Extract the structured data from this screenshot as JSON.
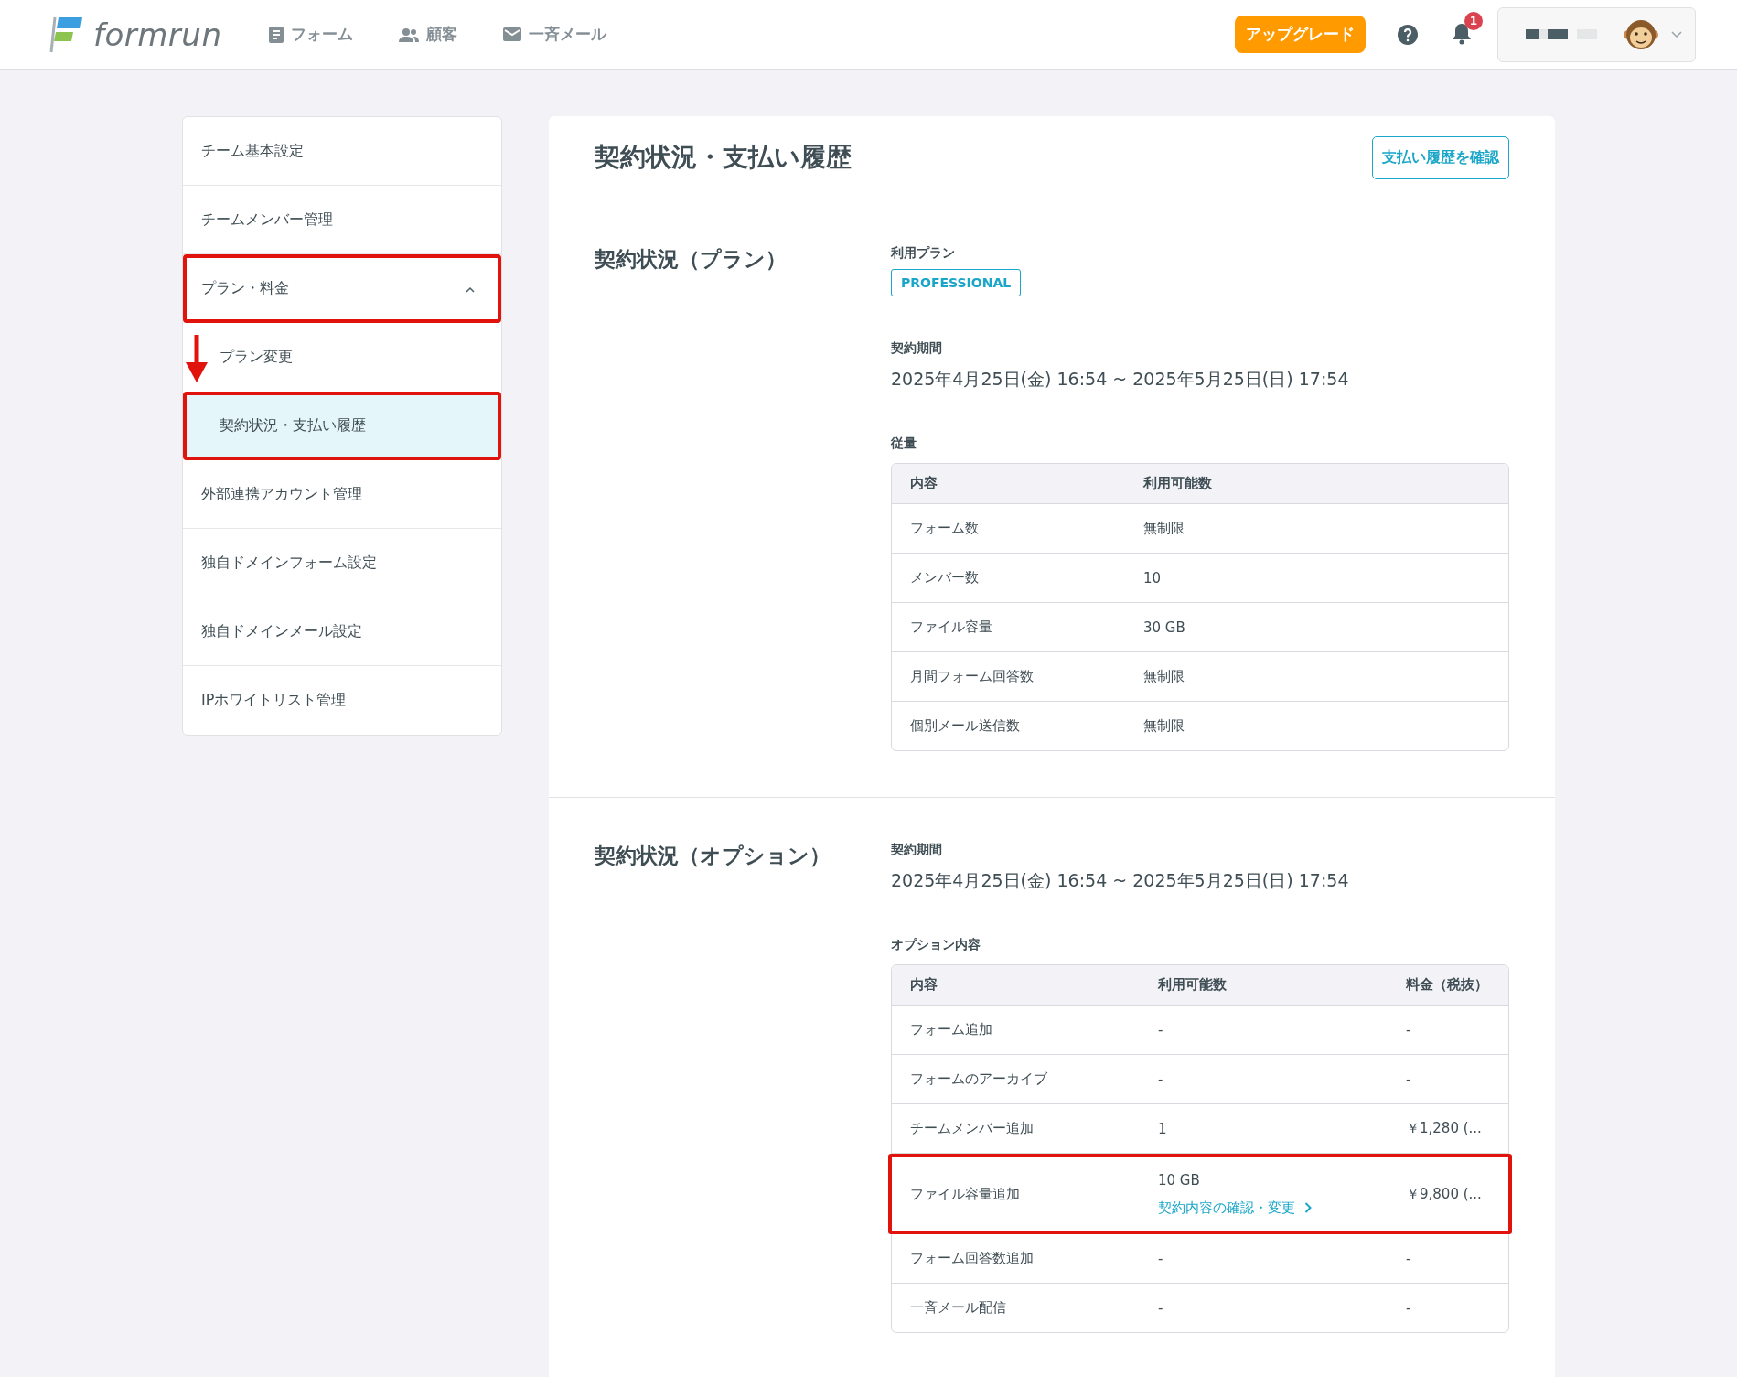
{
  "header": {
    "logo": "formrun",
    "nav": [
      {
        "kind": "form",
        "label": "フォーム"
      },
      {
        "kind": "people",
        "label": "顧客"
      },
      {
        "kind": "mail",
        "label": "一斉メール"
      }
    ],
    "upgrade": "アップグレード",
    "notification_count": "1"
  },
  "sidebar": {
    "items": [
      {
        "label": "チーム基本設定",
        "selected": false,
        "highlighted": false
      },
      {
        "label": "チームメンバー管理",
        "selected": false,
        "highlighted": false
      },
      {
        "label": "プラン・料金",
        "selected": false,
        "highlighted": true,
        "expanded": true,
        "children": [
          {
            "label": "プラン変更",
            "selected": false,
            "highlighted": false,
            "arrow": true
          },
          {
            "label": "契約状況・支払い履歴",
            "selected": true,
            "highlighted": true,
            "arrow": false
          }
        ]
      },
      {
        "label": "外部連携アカウント管理",
        "selected": false,
        "highlighted": false
      },
      {
        "label": "独自ドメインフォーム設定",
        "selected": false,
        "highlighted": false
      },
      {
        "label": "独自ドメインメール設定",
        "selected": false,
        "highlighted": false
      },
      {
        "label": "IPホワイトリスト管理",
        "selected": false,
        "highlighted": false
      }
    ]
  },
  "page": {
    "title": "契約状況・支払い履歴",
    "history_button": "支払い履歴を確認"
  },
  "plan_section": {
    "title": "契約状況（プラン）",
    "plan_label": "利用プラン",
    "plan_badge": "PROFESSIONAL",
    "period_label": "契約期間",
    "period": "2025年4月25日(金) 16:54 ~ 2025年5月25日(日) 17:54",
    "quota_label": "従量",
    "table": {
      "columns": [
        "内容",
        "利用可能数"
      ],
      "rows": [
        [
          "フォーム数",
          "無制限"
        ],
        [
          "メンバー数",
          "10"
        ],
        [
          "ファイル容量",
          "30 GB"
        ],
        [
          "月間フォーム回答数",
          "無制限"
        ],
        [
          "個別メール送信数",
          "無制限"
        ]
      ]
    }
  },
  "option_section": {
    "title": "契約状況（オプション）",
    "period_label": "契約期間",
    "period": "2025年4月25日(金) 16:54 ~ 2025年5月25日(日) 17:54",
    "options_label": "オプション内容",
    "table": {
      "columns": [
        "内容",
        "利用可能数",
        "料金（税抜）"
      ],
      "rows": [
        {
          "name": "フォーム追加",
          "amount": "-",
          "price": "-",
          "highlighted": false
        },
        {
          "name": "フォームのアーカイブ",
          "amount": "-",
          "price": "-",
          "highlighted": false
        },
        {
          "name": "チームメンバー追加",
          "amount": "1",
          "price": "￥1,280 (...",
          "highlighted": false
        },
        {
          "name": "ファイル容量追加",
          "amount": "10 GB",
          "link": "契約内容の確認・変更",
          "price": "￥9,800 (...",
          "highlighted": true
        },
        {
          "name": "フォーム回答数追加",
          "amount": "-",
          "price": "-",
          "highlighted": false
        },
        {
          "name": "一斉メール配信",
          "amount": "-",
          "price": "-",
          "highlighted": false
        }
      ]
    }
  }
}
